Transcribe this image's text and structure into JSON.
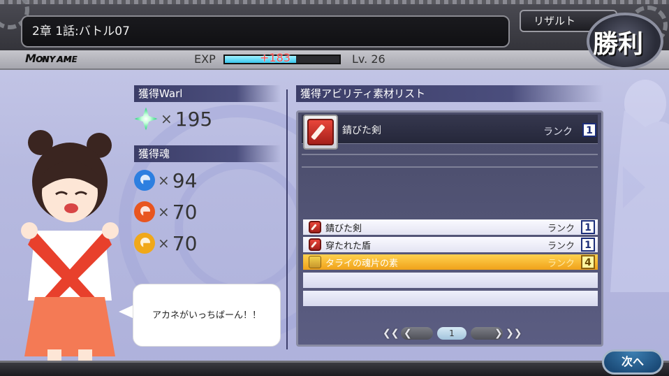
{
  "header": {
    "stage_title": "2章 1話:バトル07",
    "player_name": "Mᴏɴʏᴀᴍᴇ",
    "exp_label": "EXP",
    "exp_gain": "+183",
    "exp_progress": 0.62,
    "level": "Lv. 26",
    "result_tab": "リザルト",
    "victory": "勝利"
  },
  "rewards": {
    "warl_label": "獲得Warl",
    "warl_amount": "195",
    "soul_label": "獲得魂",
    "times": "×",
    "souls": [
      {
        "color": "#2d7fe0",
        "amount": "94"
      },
      {
        "color": "#e8551f",
        "amount": "70"
      },
      {
        "color": "#f0a81a",
        "amount": "70"
      }
    ]
  },
  "dialogue": "アカネがいっちばーん！！",
  "materials": {
    "header": "獲得アビリティ素材リスト",
    "rank_word": "ランク",
    "featured": {
      "name": "錆びた剣",
      "rank": "1"
    },
    "items": [
      {
        "name": "錆びた剣",
        "rank": "1",
        "icon": "sword-icon"
      },
      {
        "name": "穿たれた盾",
        "rank": "1",
        "icon": "shield-icon"
      },
      {
        "name": "タライの魂片の素",
        "rank": "4",
        "icon": "scroll-icon",
        "selected": true
      }
    ]
  },
  "pager": {
    "page": "1"
  },
  "next_button": "次へ"
}
